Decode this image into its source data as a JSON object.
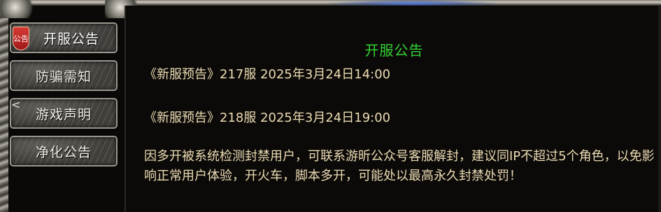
{
  "sidebar": {
    "badge_text": "公告",
    "collapse_glyph": "<",
    "items": [
      {
        "label": "开服公告",
        "active": true
      },
      {
        "label": "防骗需知",
        "active": false
      },
      {
        "label": "游戏声明",
        "active": false
      },
      {
        "label": "净化公告",
        "active": false
      }
    ]
  },
  "content": {
    "title": "开服公告",
    "lines": [
      "《新服预告》217服 2025年3月24日14:00",
      "《新服预告》218服 2025年3月24日19:00"
    ],
    "paragraph": "因多开被系统检测封禁用户，可联系游昕公众号客服解封，建议同IP不超过5个角色，以免影响正常用户体验，开火车，脚本多开，可能处以最高永久封禁处罚！"
  },
  "colors": {
    "title_green": "#34d334",
    "text_cream": "#ecdcb4",
    "badge_red": "#c0262a"
  }
}
